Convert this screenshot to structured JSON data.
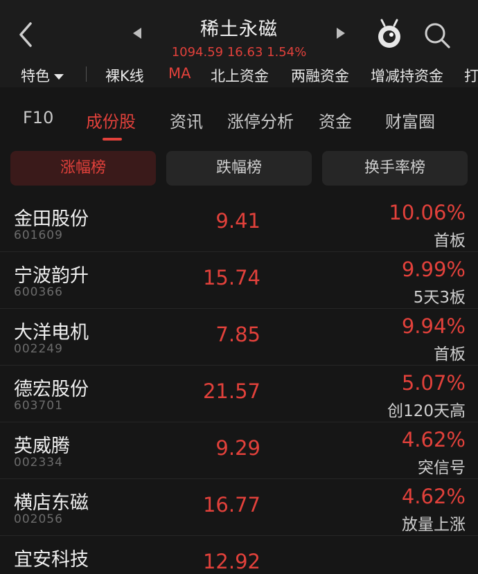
{
  "header": {
    "title": "稀土永磁",
    "quote": "1094.59 16.63 1.54%"
  },
  "subnav": {
    "items": [
      "特色",
      "裸K线",
      "MA",
      "北上资金",
      "两融资金",
      "增减持资金",
      "打"
    ]
  },
  "tabs": [
    "F10",
    "成份股",
    "资讯",
    "涨停分析",
    "资金",
    "财富圈"
  ],
  "segments": [
    "涨幅榜",
    "跌幅榜",
    "换手率榜"
  ],
  "stocks": [
    {
      "name": "金田股份",
      "code": "601609",
      "price": "9.41",
      "pct": "10.06%",
      "tag": "首板"
    },
    {
      "name": "宁波韵升",
      "code": "600366",
      "price": "15.74",
      "pct": "9.99%",
      "tag": "5天3板"
    },
    {
      "name": "大洋电机",
      "code": "002249",
      "price": "7.85",
      "pct": "9.94%",
      "tag": "首板"
    },
    {
      "name": "德宏股份",
      "code": "603701",
      "price": "21.57",
      "pct": "5.07%",
      "tag": "创120天高"
    },
    {
      "name": "英威腾",
      "code": "002334",
      "price": "9.29",
      "pct": "4.62%",
      "tag": "突信号"
    },
    {
      "name": "横店东磁",
      "code": "002056",
      "price": "16.77",
      "pct": "4.62%",
      "tag": "放量上涨"
    },
    {
      "name": "宜安科技",
      "code": "",
      "price": "12.92",
      "pct": "",
      "tag": ""
    }
  ],
  "colors": {
    "accent_red": "#e2413b",
    "background": "#161616"
  }
}
